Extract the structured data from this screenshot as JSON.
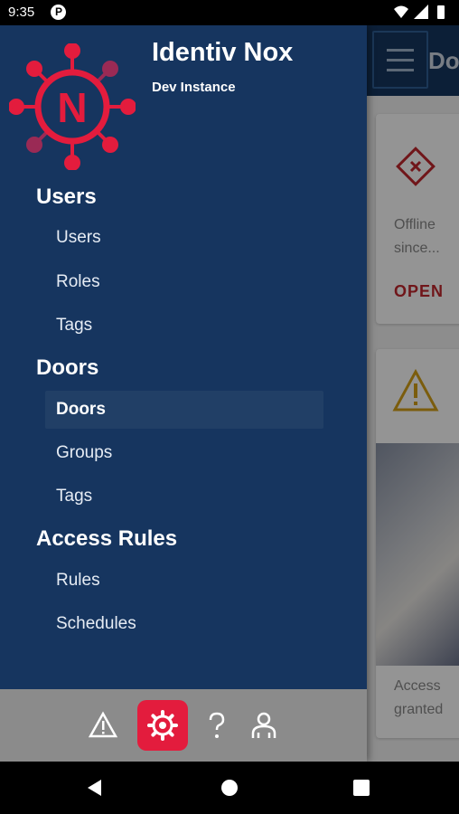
{
  "status_bar": {
    "time": "9:35",
    "app_icon_letter": "P"
  },
  "background": {
    "title_fragment": "Do",
    "card1": {
      "status_line1": "Offline",
      "status_line2": "since...",
      "action": "OPEN"
    },
    "card2": {
      "status_line1": "Access",
      "status_line2": "granted"
    }
  },
  "drawer": {
    "title": "Identiv Nox",
    "subtitle": "Dev Instance",
    "logo_letter": "N",
    "sections": [
      {
        "label": "Users",
        "items": [
          "Users",
          "Roles",
          "Tags"
        ]
      },
      {
        "label": "Doors",
        "items": [
          "Doors",
          "Groups",
          "Tags"
        ]
      },
      {
        "label": "Access Rules",
        "items": [
          "Rules",
          "Schedules"
        ]
      }
    ],
    "active_item": "Doors"
  },
  "toolbar": {
    "buttons": [
      {
        "icon": "warning-icon",
        "active": false
      },
      {
        "icon": "gear-icon",
        "active": true
      },
      {
        "icon": "help-icon",
        "active": false
      },
      {
        "icon": "user-icon",
        "active": false
      }
    ]
  },
  "colors": {
    "drawer_bg": "#16355f",
    "accent": "#e31c3d",
    "toolbar_bg": "#8b8b8b",
    "alert_red": "#c1272d",
    "warning_yellow": "#d4a017"
  }
}
